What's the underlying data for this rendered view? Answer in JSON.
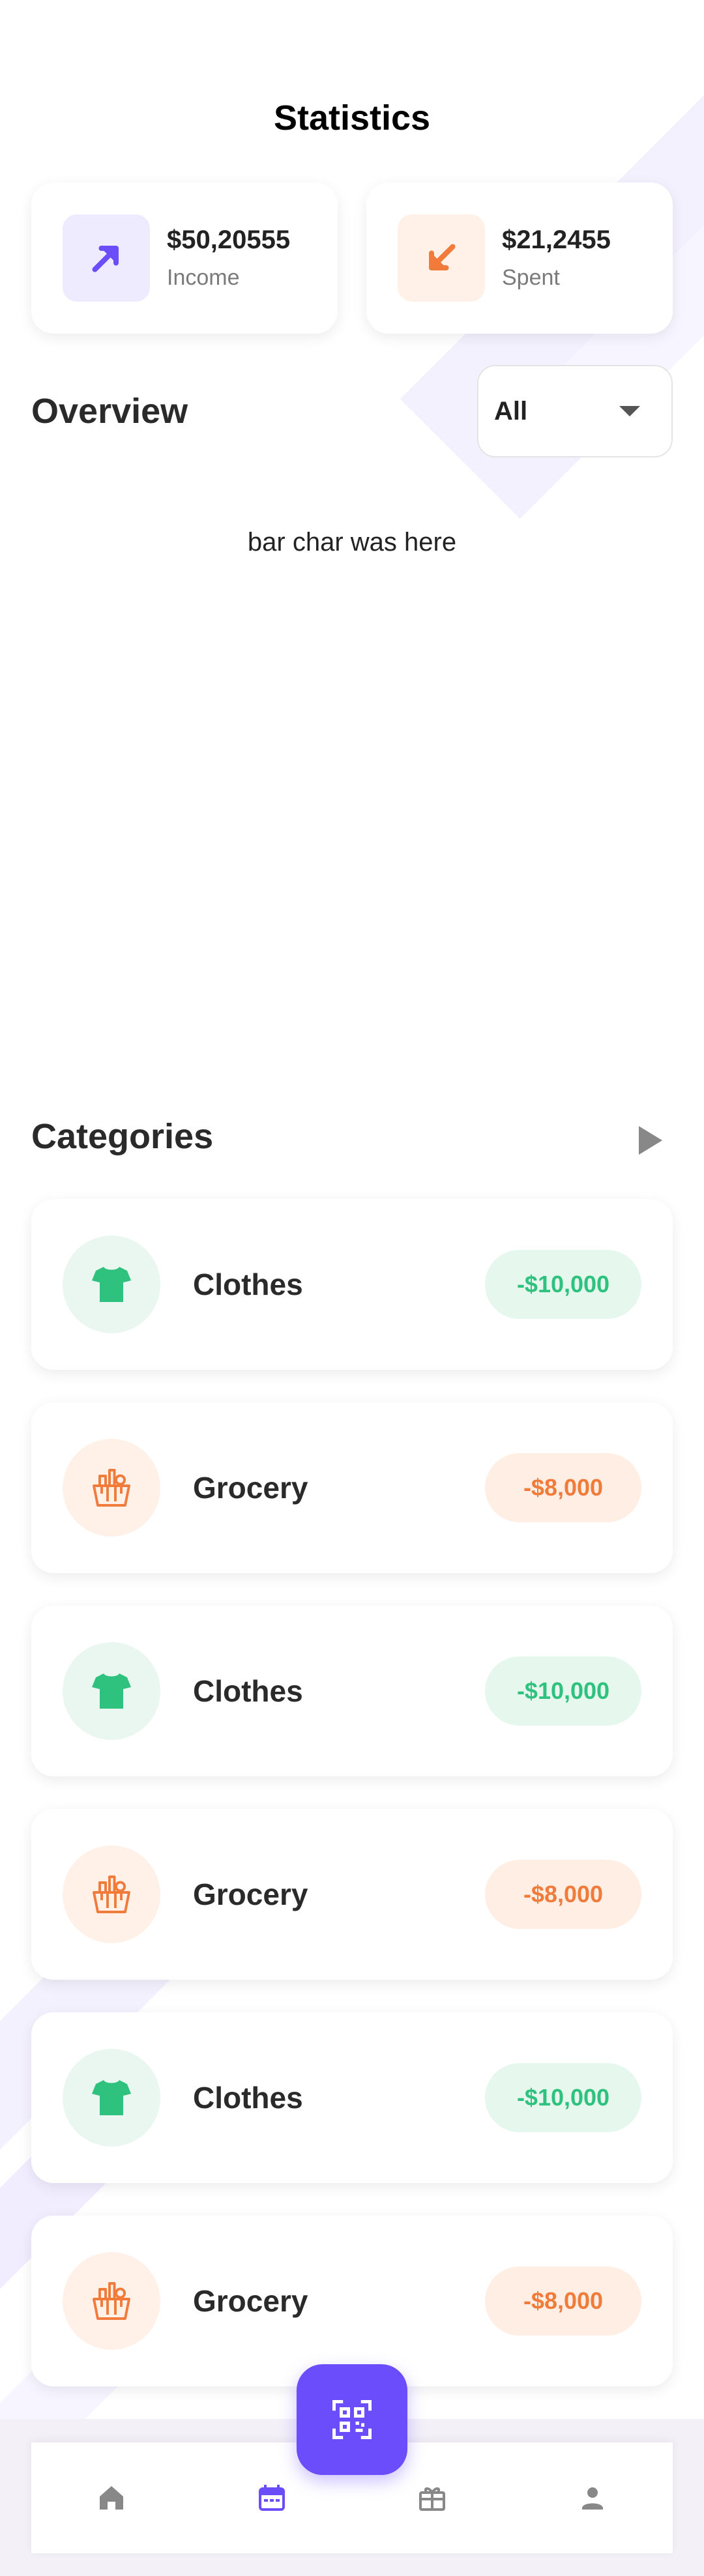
{
  "header": {
    "title": "Statistics"
  },
  "stats": {
    "income": {
      "amount": "$50,20555",
      "label": "Income",
      "icon": "arrow-up-right-icon",
      "color": "#6c4dfb"
    },
    "spent": {
      "amount": "$21,2455",
      "label": "Spent",
      "icon": "arrow-down-left-icon",
      "color": "#f07b3a"
    }
  },
  "overview": {
    "label": "Overview",
    "filter": {
      "selected": "All"
    },
    "chart_placeholder": "bar char was here"
  },
  "categories": {
    "label": "Categories",
    "items": [
      {
        "name": "Clothes",
        "amount": "-$10,000",
        "icon": "tshirt-icon",
        "accent": "#2ec27e"
      },
      {
        "name": "Grocery",
        "amount": "-$8,000",
        "icon": "grocery-basket-icon",
        "accent": "#f07b3a"
      },
      {
        "name": "Clothes",
        "amount": "-$10,000",
        "icon": "tshirt-icon",
        "accent": "#2ec27e"
      },
      {
        "name": "Grocery",
        "amount": "-$8,000",
        "icon": "grocery-basket-icon",
        "accent": "#f07b3a"
      },
      {
        "name": "Clothes",
        "amount": "-$10,000",
        "icon": "tshirt-icon",
        "accent": "#2ec27e"
      },
      {
        "name": "Grocery",
        "amount": "-$8,000",
        "icon": "grocery-basket-icon",
        "accent": "#f07b3a"
      }
    ]
  },
  "bottom_nav": {
    "active": "calendar",
    "accent": "#6c4dfb",
    "items": [
      "home-icon",
      "calendar-icon",
      "gift-icon",
      "profile-icon"
    ],
    "fab_icon": "qr-scan-icon"
  }
}
